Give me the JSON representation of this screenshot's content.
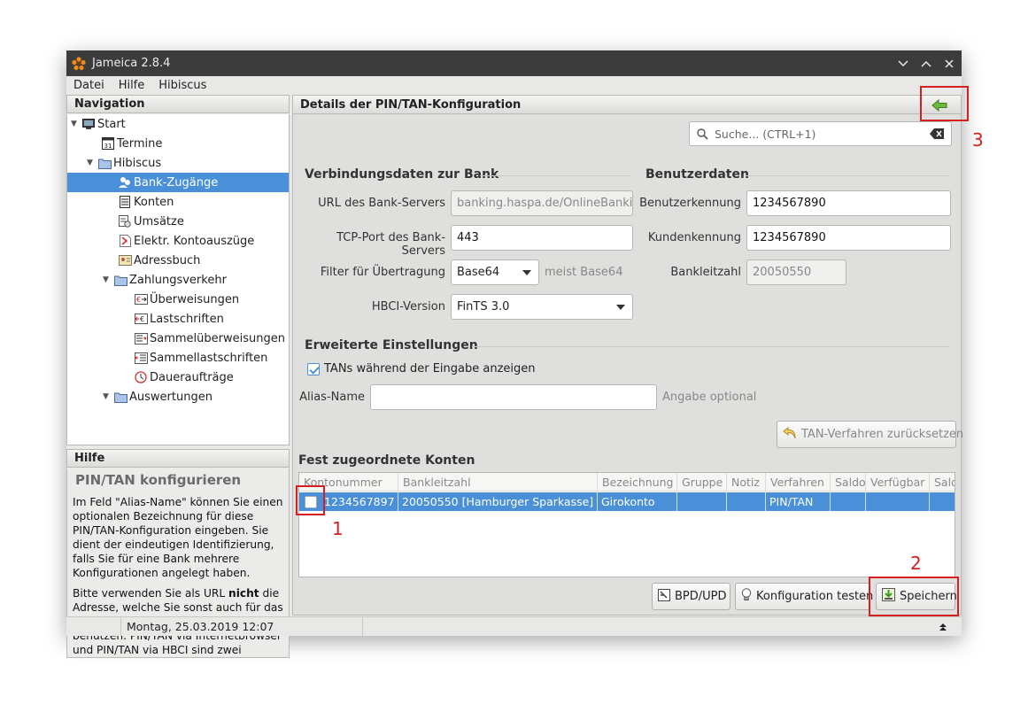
{
  "window": {
    "title": "Jameica 2.8.4"
  },
  "menu": [
    "Datei",
    "Hilfe",
    "Hibiscus"
  ],
  "navigation": {
    "header": "Navigation",
    "items": [
      {
        "label": "Start",
        "icon": "monitor-icon",
        "level": 0,
        "expanded": true
      },
      {
        "label": "Termine",
        "icon": "calendar-icon",
        "level": 1
      },
      {
        "label": "Hibiscus",
        "icon": "folder-icon",
        "level": 1,
        "expanded": true
      },
      {
        "label": "Bank-Zugänge",
        "icon": "users-icon",
        "level": 2,
        "selected": true
      },
      {
        "label": "Konten",
        "icon": "account-icon",
        "level": 2
      },
      {
        "label": "Umsätze",
        "icon": "transactions-icon",
        "level": 2
      },
      {
        "label": "Elektr. Kontoauszüge",
        "icon": "pdf-icon",
        "level": 2
      },
      {
        "label": "Adressbuch",
        "icon": "addressbook-icon",
        "level": 2
      },
      {
        "label": "Zahlungsverkehr",
        "icon": "folder-icon",
        "level": 2,
        "expanded": true
      },
      {
        "label": "Überweisungen",
        "icon": "transfer-icon",
        "level": 3
      },
      {
        "label": "Lastschriften",
        "icon": "debit-icon",
        "level": 3
      },
      {
        "label": "Sammelüberweisungen",
        "icon": "batch-transfer-icon",
        "level": 3
      },
      {
        "label": "Sammellastschriften",
        "icon": "batch-debit-icon",
        "level": 3
      },
      {
        "label": "Daueraufträge",
        "icon": "clock-icon",
        "level": 3
      },
      {
        "label": "Auswertungen",
        "icon": "folder-icon",
        "level": 2,
        "expanded": true
      }
    ]
  },
  "help": {
    "header": "Hilfe",
    "title": "PIN/TAN konfigurieren",
    "p1": "Im Feld \"Alias-Name\" können Sie einen optionalen Bezeichnung für diese PIN/TAN-Konfiguration eingeben. Sie dient der eindeutigen Identifizierung, falls Sie für eine Bank mehrere Konfigurationen angelegt haben.",
    "p2_before": "Bitte verwenden Sie als URL ",
    "p2_bold": "nicht",
    "p2_after": " die Adresse, welche Sie sonst auch für das Internet-Banking im Browser benutzen. PIN/TAN via Internetbrowser und PIN/TAN via HBCI sind zwei verschiedene"
  },
  "details": {
    "header": "Details der PIN/TAN-Konfiguration",
    "search_placeholder": "Suche...  (CTRL+1)",
    "bank_section": "Verbindungsdaten zur Bank",
    "user_section": "Benutzerdaten",
    "url_label": "URL des Bank-Servers",
    "url_value": "banking.haspa.de/OnlineBankingFinTS",
    "port_label": "TCP-Port des Bank-Servers",
    "port_value": "443",
    "filter_label": "Filter für Übertragung",
    "filter_value": "Base64",
    "filter_hint": "meist Base64",
    "hbci_label": "HBCI-Version",
    "hbci_value": "FinTS 3.0",
    "userid_label": "Benutzerkennung",
    "userid_value": "1234567890",
    "customer_label": "Kundenkennung",
    "customer_value": "1234567890",
    "blz_label": "Bankleitzahl",
    "blz_value": "20050550",
    "advanced_section": "Erweiterte Einstellungen",
    "show_tan_label": "TANs während der Eingabe anzeigen",
    "show_tan_checked": true,
    "alias_label": "Alias-Name",
    "alias_value": "",
    "alias_hint": "Angabe optional",
    "reset_tan_button": "TAN-Verfahren zurücksetzen",
    "accounts_section": "Fest zugeordnete Konten"
  },
  "accounts_table": {
    "columns": [
      "Kontonummer",
      "Bankleitzahl",
      "Bezeichnung",
      "Gruppe",
      "Notiz",
      "Verfahren",
      "Saldo",
      "Verfügbar",
      "Saldo"
    ],
    "rows": [
      {
        "kontonummer": "1234567897",
        "bankleitzahl": "20050550 [Hamburger Sparkasse]",
        "bezeichnung": "Girokonto",
        "gruppe": "",
        "notiz": "",
        "verfahren": "PIN/TAN",
        "saldo": "",
        "verfuegbar": "",
        "saldo2": ""
      }
    ]
  },
  "buttons": {
    "bpd": "BPD/UPD",
    "test": "Konfiguration testen",
    "save": "Speichern"
  },
  "status": {
    "datetime": "Montag, 25.03.2019 12:07"
  },
  "annotations": {
    "one": "1",
    "two": "2",
    "three": "3"
  },
  "colors": {
    "selection": "#4a90d9",
    "annotation": "#d42020",
    "titlebar": "#3c3c3c"
  }
}
